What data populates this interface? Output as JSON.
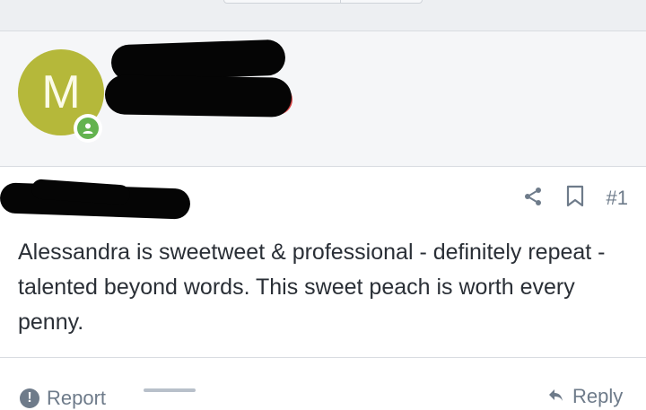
{
  "post": {
    "avatar_letter": "M",
    "number": "#1",
    "body": "Alessandra is sweetweet & professional - definitely repeat - talented beyond words. This sweet peach is worth every penny."
  },
  "footer": {
    "report_label": "Report",
    "reply_label": "Reply"
  },
  "colors": {
    "avatar_bg": "#b5b83a",
    "online_badge": "#63b34f",
    "meta_gray": "#6e7b8a"
  },
  "icons": [
    "share-icon",
    "bookmark-icon",
    "user-online-icon",
    "report-icon",
    "reply-icon"
  ]
}
